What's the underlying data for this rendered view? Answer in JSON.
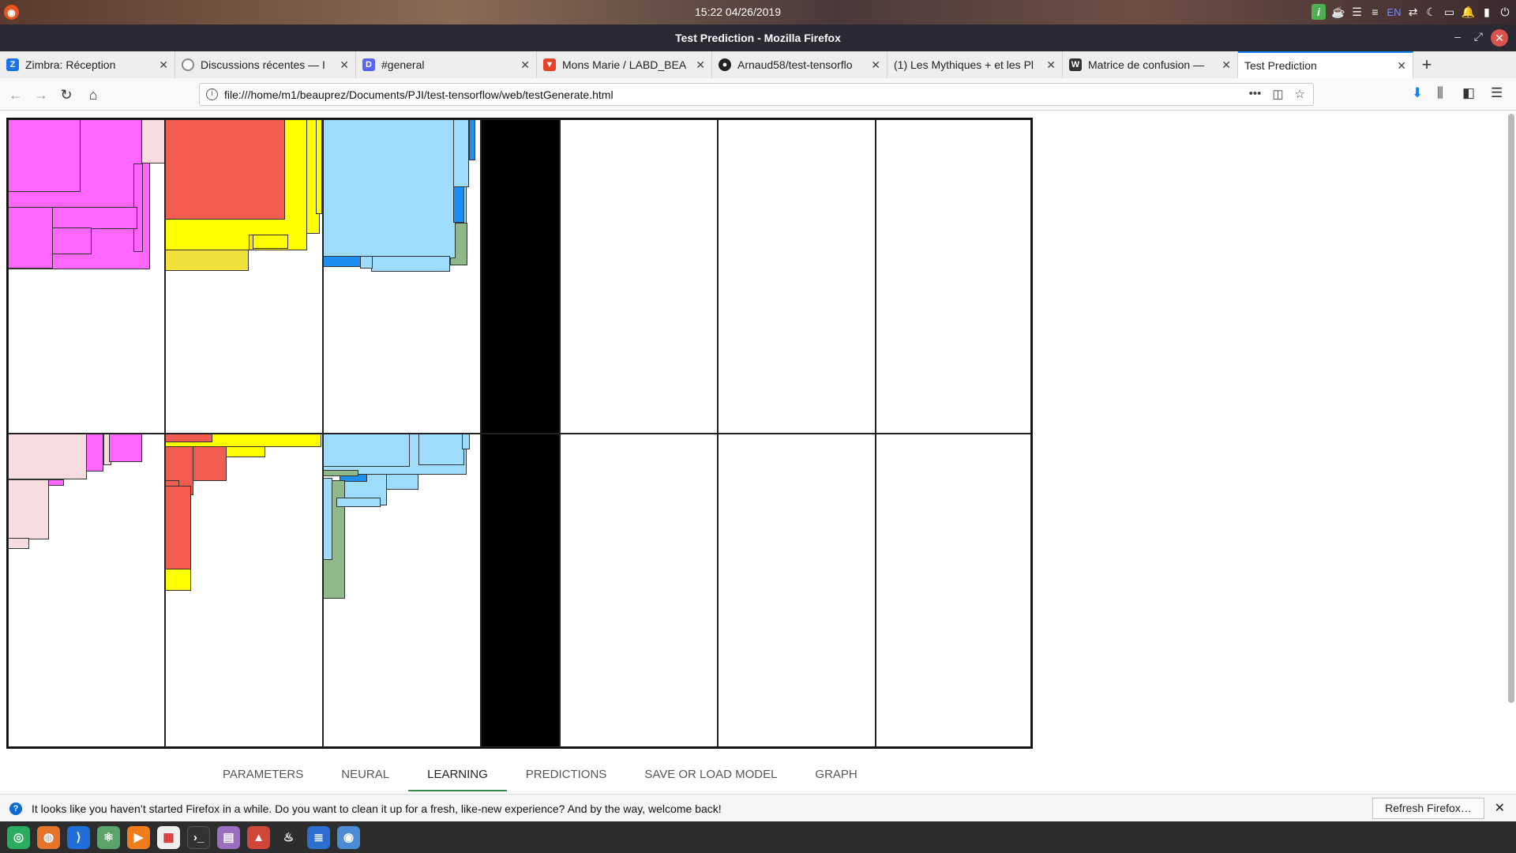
{
  "os_bar": {
    "clock": "15:22  04/26/2019",
    "lang": "EN"
  },
  "window": {
    "title": "Test Prediction - Mozilla Firefox"
  },
  "tabs": [
    {
      "label": "Zimbra: Réception",
      "icon": "zimbra-icon",
      "color": "#1a73e8",
      "glyph": "Z"
    },
    {
      "label": "Discussions récentes — I",
      "icon": "discourse-icon",
      "color": "#888888",
      "glyph": "◌"
    },
    {
      "label": "#general",
      "icon": "discord-icon",
      "color": "#5865f2",
      "glyph": "D"
    },
    {
      "label": "Mons Marie / LABD_BEA",
      "icon": "gitlab-icon",
      "color": "#e24329",
      "glyph": "G"
    },
    {
      "label": "Arnaud58/test-tensorflo",
      "icon": "github-icon",
      "color": "#222222",
      "glyph": "●"
    },
    {
      "label": "(1) Les Mythiques + et les Pl",
      "icon": "page-icon",
      "color": "#cccccc",
      "glyph": ""
    },
    {
      "label": "Matrice de confusion —",
      "icon": "wikipedia-icon",
      "color": "#333333",
      "glyph": "W"
    },
    {
      "label": "Test Prediction",
      "icon": "none",
      "color": "",
      "glyph": ""
    }
  ],
  "nav": {
    "url": "file:///home/m1/beauprez/Documents/PJI/test-tensorflow/web/testGenerate.html"
  },
  "bottom_tabs": [
    {
      "label": "PARAMETERS"
    },
    {
      "label": "NEURAL"
    },
    {
      "label": "LEARNING",
      "active": true
    },
    {
      "label": "PREDICTIONS"
    },
    {
      "label": "SAVE OR LOAD MODEL"
    },
    {
      "label": "GRAPH"
    }
  ],
  "notification": {
    "message": "It looks like you haven’t started Firefox in a while. Do you want to clean it up for a fresh, like-new experience? And by the way, welcome back!",
    "button": "Refresh Firefox…"
  },
  "colors": {
    "magenta": "#ff66ff",
    "pink_light": "#f7dde0",
    "red": "#f25c50",
    "yellow": "#ffff00",
    "gold": "#f2e03a",
    "light_blue": "#9ddcfb",
    "blue": "#1e8ff0",
    "green": "#8fb98b"
  }
}
